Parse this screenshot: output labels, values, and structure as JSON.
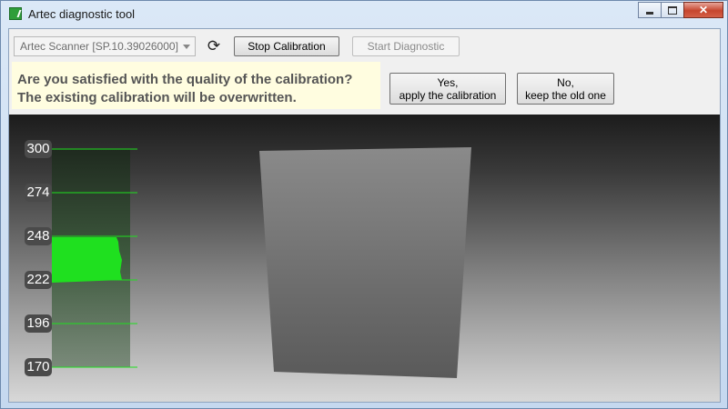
{
  "window": {
    "title": "Artec diagnostic tool"
  },
  "toolbar": {
    "scanner_select": "Artec Scanner [SP.10.39026000]",
    "stop_label": "Stop Calibration",
    "start_label": "Start Diagnostic"
  },
  "prompt": {
    "question_line1": "Are you satisfied with the quality of the calibration?",
    "question_line2": "The existing calibration will be overwritten.",
    "yes_line1": "Yes,",
    "yes_line2": "apply the calibration",
    "no_line1": "No,",
    "no_line2": "keep the old one"
  },
  "depth_scale": {
    "ticks": [
      "300",
      "274",
      "248",
      "222",
      "196",
      "170"
    ],
    "highlight_range": [
      222,
      248
    ],
    "accent_color": "#1fe01f"
  }
}
